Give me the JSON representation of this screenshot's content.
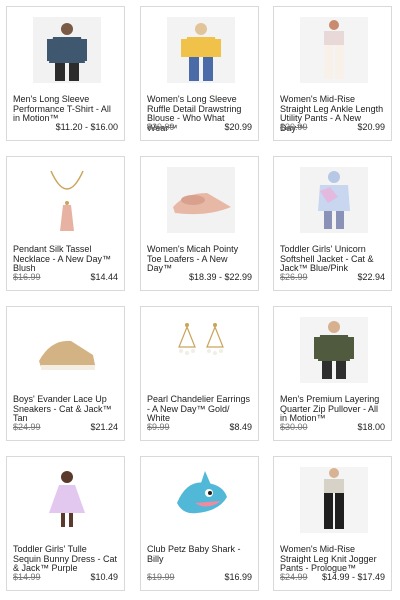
{
  "products": [
    {
      "title": "Men's Long Sleeve\nPerformance T-Shirt - All\nin Motion™",
      "was": "",
      "price": "$11.20 - $16.00",
      "icon": "mens-shirt-image"
    },
    {
      "title": "Women's Long Sleeve\nRuffle Detail Drawstring\nBlouse - Who What\nWear™",
      "was": "$29.99",
      "price": "$20.99",
      "icon": "womens-blouse-image"
    },
    {
      "title": "Women's Mid-Rise\nStraight Leg Ankle Length\n Utility Pants - A New\nDay™",
      "was": "$29.99",
      "price": "$20.99",
      "icon": "utility-pants-image"
    },
    {
      "title": "Pendant Silk Tassel\nNecklace -  A New Day™\nBlush",
      "was": "$16.99",
      "price": "$14.44",
      "icon": "tassel-necklace-image"
    },
    {
      "title": "Women's Micah Pointy\nToe Loafers - A New\nDay™",
      "was": "",
      "price": "$18.39 - $22.99",
      "icon": "loafers-image"
    },
    {
      "title": "Toddler Girls' Unicorn\nSoftshell Jacket - Cat &\nJack™ Blue/Pink",
      "was": "$26.99",
      "price": "$22.94",
      "icon": "unicorn-jacket-image"
    },
    {
      "title": "Boys' Evander Lace Up\nSneakers - Cat & Jack™\nTan",
      "was": "$24.99",
      "price": "$21.24",
      "icon": "sneakers-image"
    },
    {
      "title": "Pearl Chandelier Earrings\n - A New Day™ Gold/\nWhite",
      "was": "$9.99",
      "price": "$8.49",
      "icon": "earrings-image"
    },
    {
      "title": "Men's Premium Layering\nQuarter Zip Pullover - All\nin Motion™",
      "was": "$30.00",
      "price": "$18.00",
      "icon": "quarter-zip-image"
    },
    {
      "title": "Toddler Girls' Tulle\nSequin Bunny Dress - Cat\n& Jack™ Purple",
      "was": "$14.99",
      "price": "$10.49",
      "icon": "bunny-dress-image"
    },
    {
      "title": "Club Petz Baby Shark -\nBilly",
      "was": "$19.99",
      "price": "$16.99",
      "icon": "baby-shark-image"
    },
    {
      "title": "Women's Mid-Rise\nStraight Leg Knit Jogger\nPants - Prologue™",
      "was": "$24.99",
      "price": "$14.99 - $17.49",
      "icon": "jogger-pants-image"
    }
  ]
}
